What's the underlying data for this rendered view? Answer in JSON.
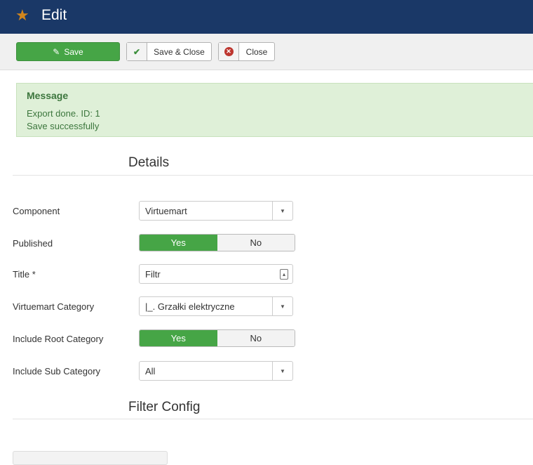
{
  "header": {
    "title": "Edit"
  },
  "toolbar": {
    "save": "Save",
    "save_close": "Save & Close",
    "close": "Close"
  },
  "message": {
    "heading": "Message",
    "lines": [
      "Export done. ID: 1",
      "Save successfully"
    ]
  },
  "sections": {
    "details": "Details",
    "filter_config": "Filter Config"
  },
  "form": {
    "component": {
      "label": "Component",
      "value": "Virtuemart"
    },
    "published": {
      "label": "Published",
      "yes": "Yes",
      "no": "No",
      "selected": "Yes"
    },
    "title": {
      "label": "Title  *",
      "value": "Filtr"
    },
    "vm_category": {
      "label": "Virtuemart Category",
      "value": "|_. Grzałki elektryczne"
    },
    "include_root": {
      "label": "Include Root Category",
      "yes": "Yes",
      "no": "No",
      "selected": "Yes"
    },
    "include_sub": {
      "label": "Include Sub Category",
      "value": "All"
    }
  },
  "colors": {
    "header": "#1a3867",
    "success": "#46a546",
    "accent": "#d1861d"
  }
}
